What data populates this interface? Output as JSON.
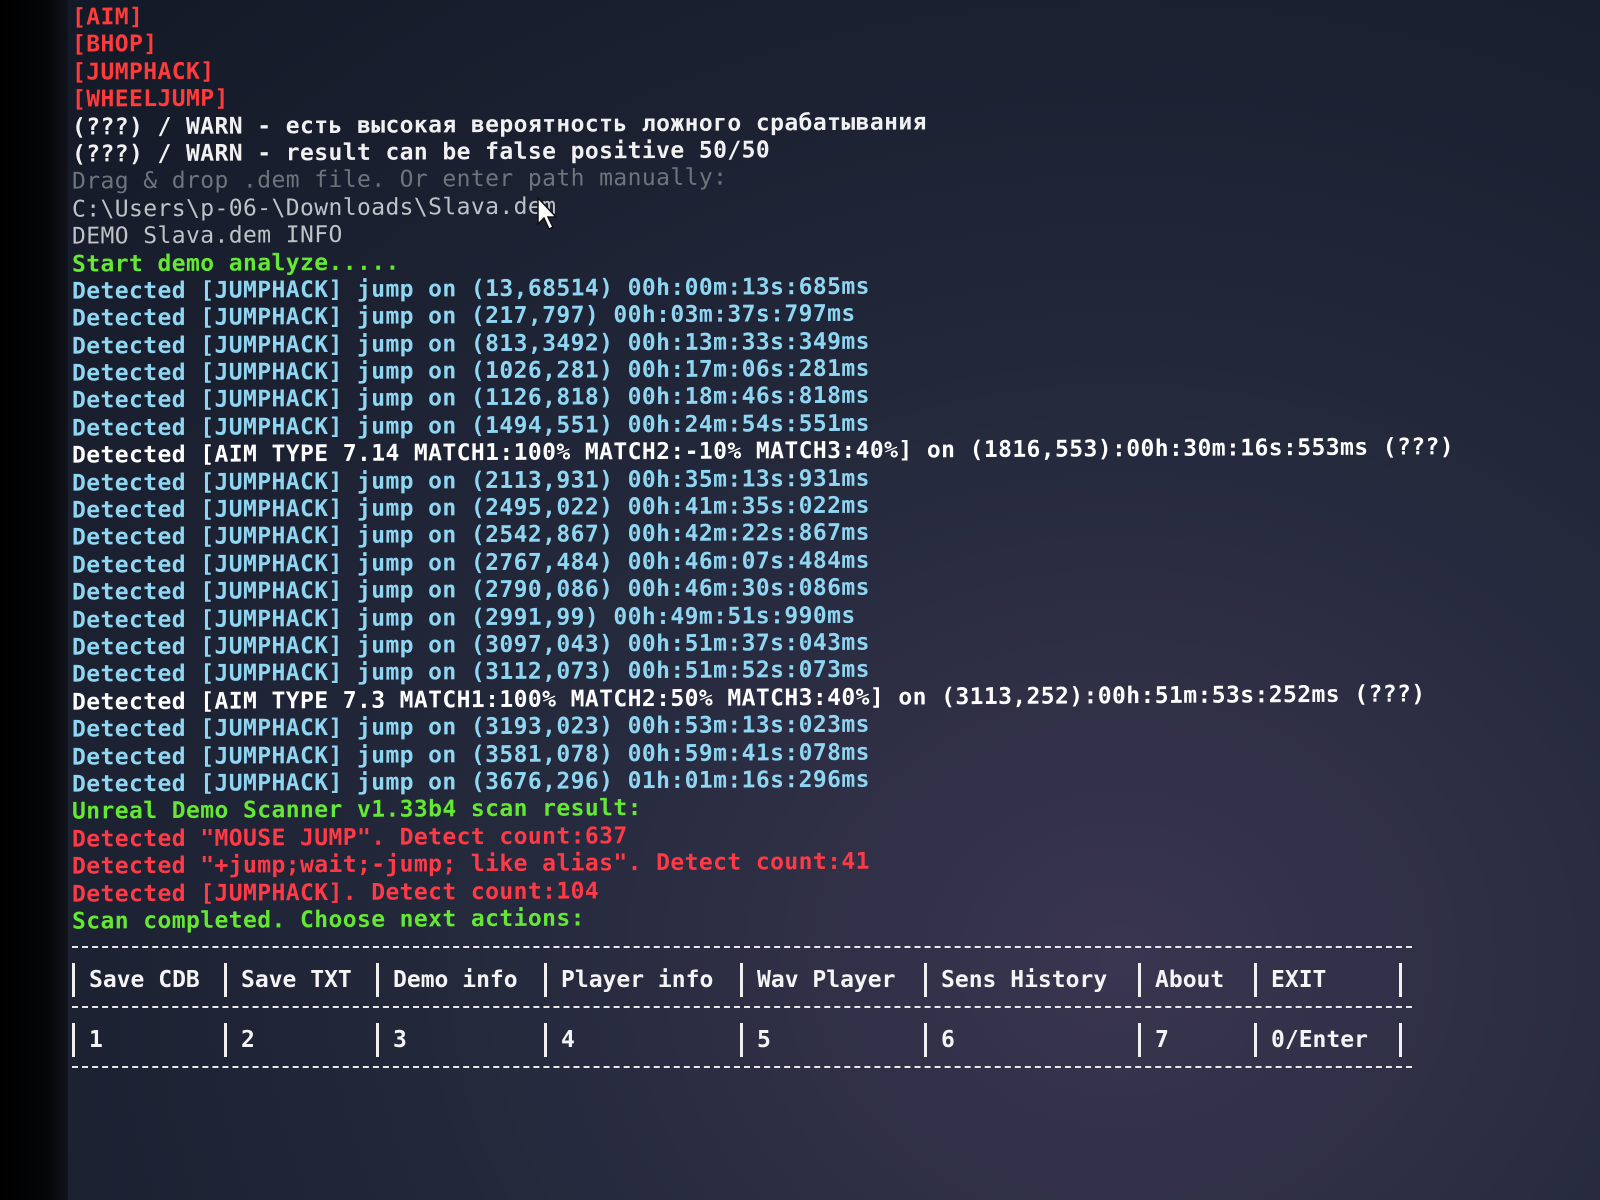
{
  "console": {
    "lines": [
      {
        "text": "[AIM]",
        "style": "redtag"
      },
      {
        "text": "[BHOP]",
        "style": "redtag"
      },
      {
        "text": "[JUMPHACK]",
        "style": "redtag"
      },
      {
        "text": "[WHEELJUMP]",
        "style": "redtag"
      },
      {
        "text": "(???) / WARN - есть высокая вероятность ложного срабатывания",
        "style": "white"
      },
      {
        "text": "(???) / WARN - result can be false positive 50/50",
        "style": "white"
      },
      {
        "text": "Drag & drop .dem file. Or enter path manually:",
        "style": "dimgray"
      },
      {
        "text": "C:\\Users\\p-06-\\Downloads\\Slava.dem",
        "style": "gray"
      },
      {
        "text": "DEMO Slava.dem INFO",
        "style": "gray"
      },
      {
        "text": "Start demo analyze.....",
        "style": "green"
      },
      {
        "text": "Detected [JUMPHACK] jump on (13,68514) 00h:00m:13s:685ms",
        "style": "cyan"
      },
      {
        "text": "Detected [JUMPHACK] jump on (217,797) 00h:03m:37s:797ms",
        "style": "cyan"
      },
      {
        "text": "Detected [JUMPHACK] jump on (813,3492) 00h:13m:33s:349ms",
        "style": "cyan"
      },
      {
        "text": "Detected [JUMPHACK] jump on (1026,281) 00h:17m:06s:281ms",
        "style": "cyan"
      },
      {
        "text": "Detected [JUMPHACK] jump on (1126,818) 00h:18m:46s:818ms",
        "style": "cyan"
      },
      {
        "text": "Detected [JUMPHACK] jump on (1494,551) 00h:24m:54s:551ms",
        "style": "cyan"
      },
      {
        "text": "Detected [AIM TYPE 7.14 MATCH1:100% MATCH2:-10% MATCH3:40%] on (1816,553):00h:30m:16s:553ms (???)",
        "style": "whitebold"
      },
      {
        "text": "Detected [JUMPHACK] jump on (2113,931) 00h:35m:13s:931ms",
        "style": "cyan"
      },
      {
        "text": "Detected [JUMPHACK] jump on (2495,022) 00h:41m:35s:022ms",
        "style": "cyan"
      },
      {
        "text": "Detected [JUMPHACK] jump on (2542,867) 00h:42m:22s:867ms",
        "style": "cyan"
      },
      {
        "text": "Detected [JUMPHACK] jump on (2767,484) 00h:46m:07s:484ms",
        "style": "cyan"
      },
      {
        "text": "Detected [JUMPHACK] jump on (2790,086) 00h:46m:30s:086ms",
        "style": "cyan"
      },
      {
        "text": "Detected [JUMPHACK] jump on (2991,99) 00h:49m:51s:990ms",
        "style": "cyan"
      },
      {
        "text": "Detected [JUMPHACK] jump on (3097,043) 00h:51m:37s:043ms",
        "style": "cyan"
      },
      {
        "text": "Detected [JUMPHACK] jump on (3112,073) 00h:51m:52s:073ms",
        "style": "cyan"
      },
      {
        "text": "Detected [AIM TYPE 7.3 MATCH1:100% MATCH2:50% MATCH3:40%] on (3113,252):00h:51m:53s:252ms (???)",
        "style": "whitebold"
      },
      {
        "text": "Detected [JUMPHACK] jump on (3193,023) 00h:53m:13s:023ms",
        "style": "cyan"
      },
      {
        "text": "Detected [JUMPHACK] jump on (3581,078) 00h:59m:41s:078ms",
        "style": "cyan"
      },
      {
        "text": "Detected [JUMPHACK] jump on (3676,296) 01h:01m:16s:296ms",
        "style": "cyan"
      },
      {
        "text": "Unreal Demo Scanner v1.33b4 scan result:",
        "style": "green"
      },
      {
        "text": "Detected \"MOUSE JUMP\". Detect count:637",
        "style": "redres"
      },
      {
        "text": "Detected \"+jump;wait;-jump; like alias\". Detect count:41",
        "style": "redres"
      },
      {
        "text": "Detected [JUMPHACK]. Detect count:104",
        "style": "redres"
      },
      {
        "text": "Scan completed. Choose next actions:",
        "style": "green"
      }
    ]
  },
  "menu": {
    "labels": [
      "Save CDB",
      "Save TXT",
      "Demo info",
      "Player info",
      "Wav Player",
      "Sens History",
      "About",
      "EXIT"
    ],
    "keys": [
      "1",
      "2",
      "3",
      "4",
      "5",
      "6",
      "7",
      "0/Enter"
    ]
  },
  "colors": {
    "cyan": "#8fd6f2",
    "green": "#64e833",
    "red": "#ff3a46",
    "white": "#f1f1f1"
  },
  "icons": {
    "cursor": "mouse-pointer-icon"
  }
}
